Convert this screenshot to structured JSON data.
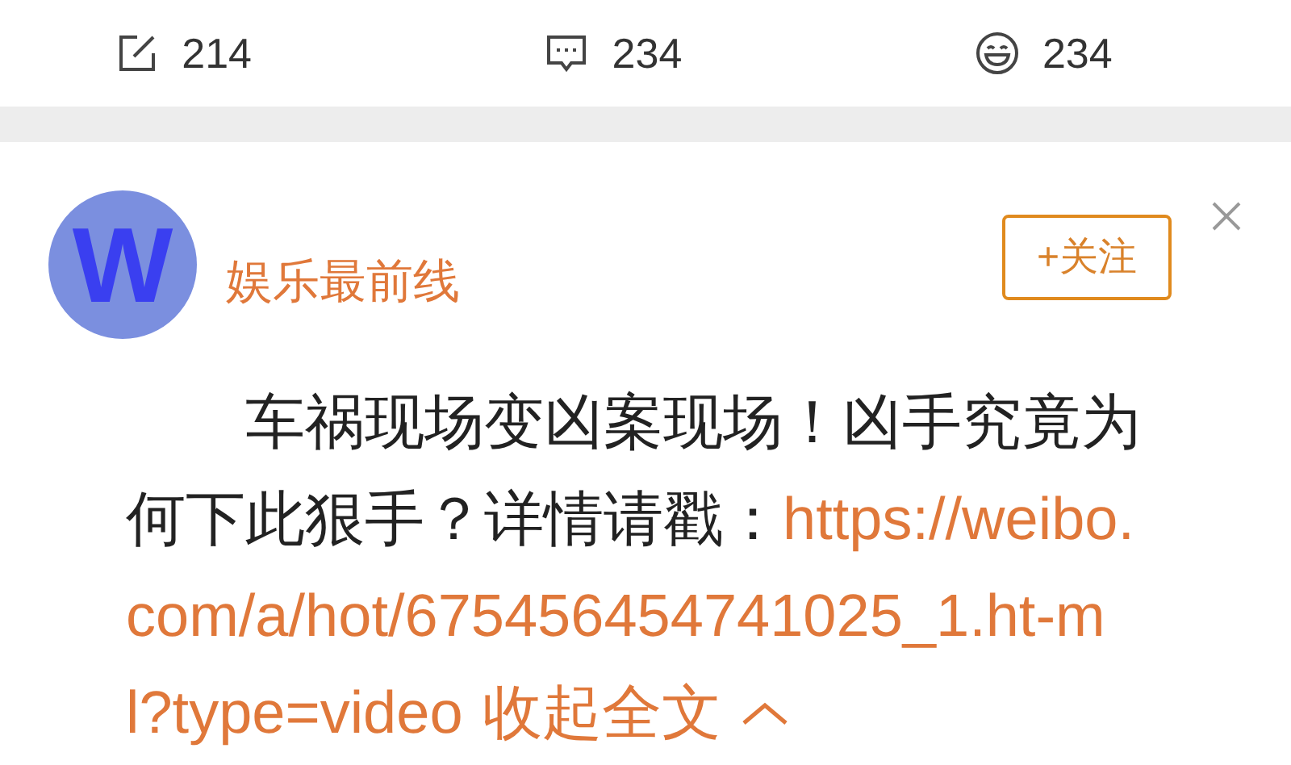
{
  "actions": [
    {
      "kind": "repost",
      "count": "214"
    },
    {
      "kind": "comment",
      "count": "234"
    },
    {
      "kind": "like",
      "count": "234"
    }
  ],
  "post": {
    "avatar_letter": "W",
    "author": "娱乐最前线",
    "follow_button": "+关注",
    "text_lines": [
      "车祸现场变凶案现场！凶手究竟为",
      "何下此狠手？详情请戳："
    ],
    "link_lines": [
      "https://weibo.",
      "com/a/hot/675456454741025_1.ht-m",
      "l?type=video"
    ],
    "collapse": "收起全文"
  }
}
